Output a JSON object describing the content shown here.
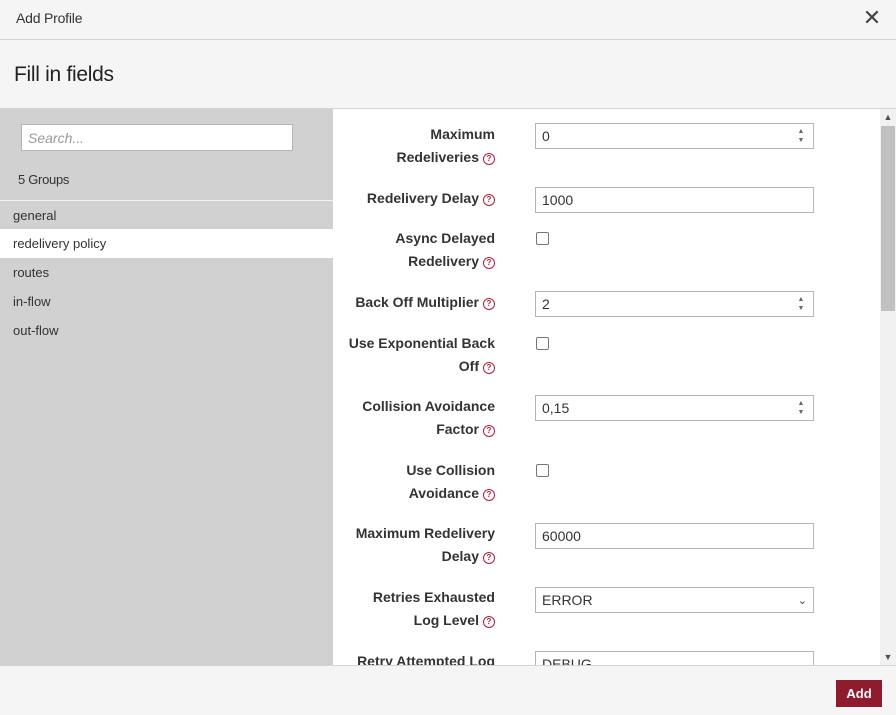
{
  "dialog": {
    "title": "Add Profile",
    "close_symbol": "✕",
    "subtitle": "Fill in fields"
  },
  "sidebar": {
    "search_placeholder": "Search...",
    "group_count": "5 Groups",
    "groups": [
      {
        "label": "general",
        "active": false
      },
      {
        "label": "redelivery policy",
        "active": true
      },
      {
        "label": "routes",
        "active": false
      },
      {
        "label": "in-flow",
        "active": false
      },
      {
        "label": "out-flow",
        "active": false
      }
    ]
  },
  "form": {
    "fields": [
      {
        "label_line1": "Maximum",
        "label_line2": "Redeliveries",
        "type": "number",
        "value": "0"
      },
      {
        "label_line1": "Redelivery Delay",
        "label_line2": "",
        "type": "text",
        "value": "1000"
      },
      {
        "label_line1": "Async Delayed",
        "label_line2": "Redelivery",
        "type": "checkbox",
        "value": false
      },
      {
        "label_line1": "Back Off Multiplier",
        "label_line2": "",
        "type": "number",
        "value": "2"
      },
      {
        "label_line1": "Use Exponential Back",
        "label_line2": "Off",
        "type": "checkbox",
        "value": false
      },
      {
        "label_line1": "Collision Avoidance",
        "label_line2": "Factor",
        "type": "number",
        "value": "0,15"
      },
      {
        "label_line1": "Use Collision",
        "label_line2": "Avoidance",
        "type": "checkbox",
        "value": false
      },
      {
        "label_line1": "Maximum Redelivery",
        "label_line2": "Delay",
        "type": "text",
        "value": "60000"
      },
      {
        "label_line1": "Retries Exhausted",
        "label_line2": "Log Level",
        "type": "select",
        "value": "ERROR"
      },
      {
        "label_line1": "Retry Attempted Log",
        "label_line2": "",
        "type": "select",
        "value": "DEBUG"
      }
    ],
    "help_symbol": "?"
  },
  "footer": {
    "add_label": "Add"
  },
  "colors": {
    "accent": "#8f1c2e",
    "help": "#b01e3a",
    "sidebar_bg": "#d1d1d1"
  },
  "icons": {
    "close": "close-icon",
    "help": "question-circle-icon",
    "spinner": "spinner-arrows-icon",
    "dropdown": "chevron-down-icon",
    "scroll_up": "scroll-up-icon",
    "scroll_down": "scroll-down-icon"
  }
}
